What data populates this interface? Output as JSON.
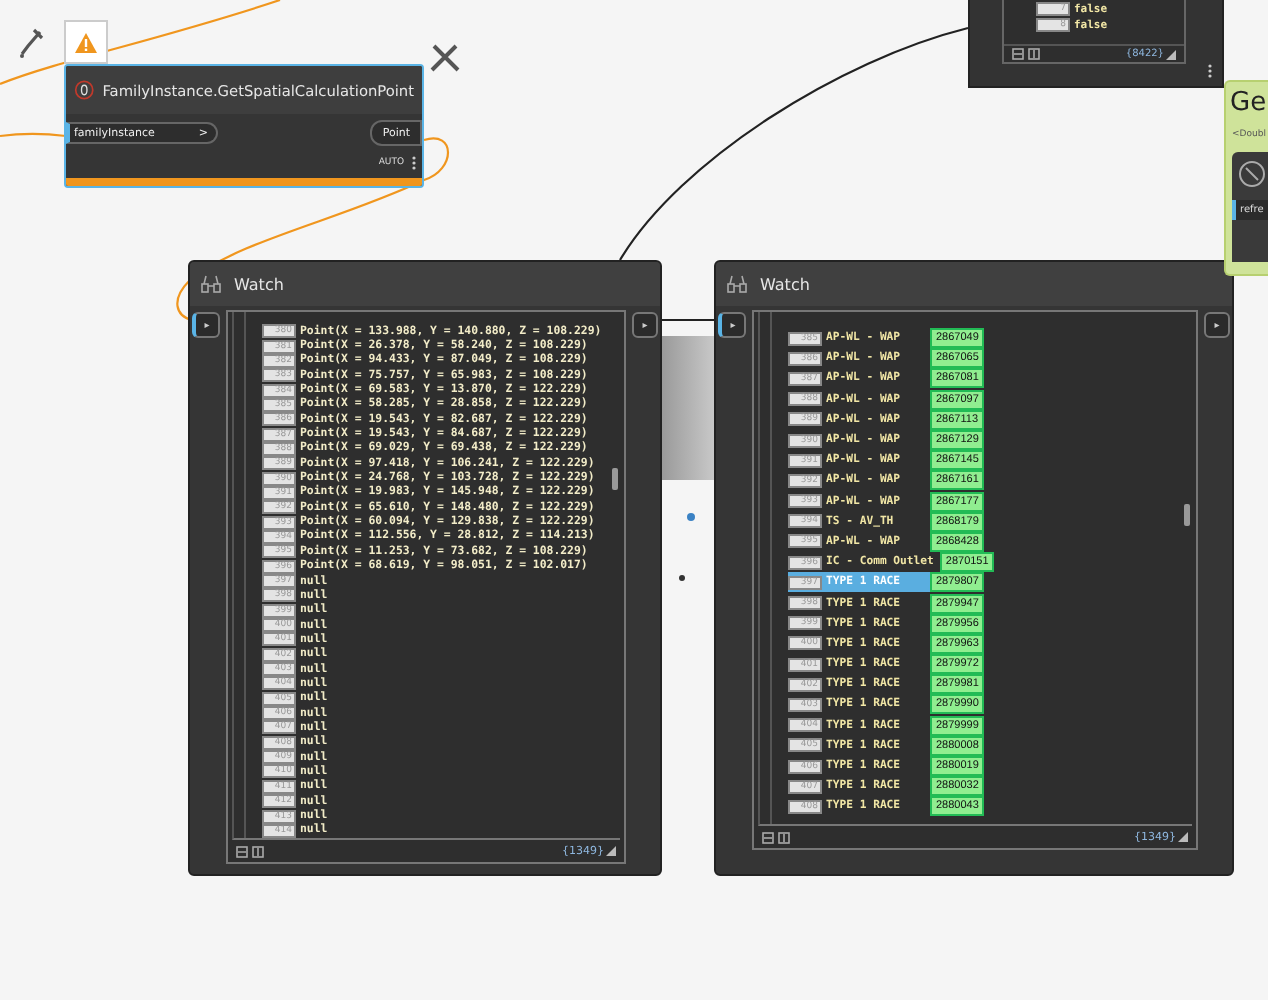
{
  "function_node": {
    "title": "FamilyInstance.GetSpatialCalculationPoint",
    "warning": true,
    "inputs": [
      {
        "label": "familyInstance",
        "arrow": ">"
      }
    ],
    "outputs": [
      "Point"
    ],
    "lacing": "AUTO"
  },
  "top_watch": {
    "rows": [
      {
        "index": "7",
        "value": "false"
      },
      {
        "index": "8",
        "value": "false"
      }
    ],
    "count": "{8422}"
  },
  "watch_nodes": [
    {
      "title": "Watch",
      "kind": "values",
      "input_arrow": "▸",
      "output_arrow": "▸",
      "count": "{1349}",
      "rows": [
        {
          "index": "380",
          "value": "Point(X = 133.988, Y = 140.880, Z = 108.229)"
        },
        {
          "index": "381",
          "value": "Point(X = 26.378, Y = 58.240, Z = 108.229)"
        },
        {
          "index": "382",
          "value": "Point(X = 94.433, Y = 87.049, Z = 108.229)"
        },
        {
          "index": "383",
          "value": "Point(X = 75.757, Y = 65.983, Z = 108.229)"
        },
        {
          "index": "384",
          "value": "Point(X = 69.583, Y = 13.870, Z = 122.229)"
        },
        {
          "index": "385",
          "value": "Point(X = 58.285, Y = 28.858, Z = 122.229)"
        },
        {
          "index": "386",
          "value": "Point(X = 19.543, Y = 82.687, Z = 122.229)"
        },
        {
          "index": "387",
          "value": "Point(X = 19.543, Y = 84.687, Z = 122.229)"
        },
        {
          "index": "388",
          "value": "Point(X = 69.029, Y = 69.438, Z = 122.229)"
        },
        {
          "index": "389",
          "value": "Point(X = 97.418, Y = 106.241, Z = 122.229)"
        },
        {
          "index": "390",
          "value": "Point(X = 24.768, Y = 103.728, Z = 122.229)"
        },
        {
          "index": "391",
          "value": "Point(X = 19.983, Y = 145.948, Z = 122.229)"
        },
        {
          "index": "392",
          "value": "Point(X = 65.610, Y = 148.480, Z = 122.229)"
        },
        {
          "index": "393",
          "value": "Point(X = 60.094, Y = 129.838, Z = 122.229)"
        },
        {
          "index": "394",
          "value": "Point(X = 112.556, Y = 28.812, Z = 114.213)"
        },
        {
          "index": "395",
          "value": "Point(X = 11.253, Y = 73.682, Z = 108.229)"
        },
        {
          "index": "396",
          "value": "Point(X = 68.619, Y = 98.051, Z = 102.017)"
        },
        {
          "index": "397",
          "value": "null"
        },
        {
          "index": "398",
          "value": "null"
        },
        {
          "index": "399",
          "value": "null"
        },
        {
          "index": "400",
          "value": "null"
        },
        {
          "index": "401",
          "value": "null"
        },
        {
          "index": "402",
          "value": "null"
        },
        {
          "index": "403",
          "value": "null"
        },
        {
          "index": "404",
          "value": "null"
        },
        {
          "index": "405",
          "value": "null"
        },
        {
          "index": "406",
          "value": "null"
        },
        {
          "index": "407",
          "value": "null"
        },
        {
          "index": "408",
          "value": "null"
        },
        {
          "index": "409",
          "value": "null"
        },
        {
          "index": "410",
          "value": "null"
        },
        {
          "index": "411",
          "value": "null"
        },
        {
          "index": "412",
          "value": "null"
        },
        {
          "index": "413",
          "value": "null"
        },
        {
          "index": "414",
          "value": "null"
        }
      ]
    },
    {
      "title": "Watch",
      "kind": "elements",
      "input_arrow": "▸",
      "output_arrow": "▸",
      "count": "{1349}",
      "rows": [
        {
          "index": "385",
          "name": "AP-WL - WAP",
          "id": "2867049",
          "selected": false
        },
        {
          "index": "386",
          "name": "AP-WL - WAP",
          "id": "2867065",
          "selected": false
        },
        {
          "index": "387",
          "name": "AP-WL - WAP",
          "id": "2867081",
          "selected": false
        },
        {
          "index": "388",
          "name": "AP-WL - WAP",
          "id": "2867097",
          "selected": false
        },
        {
          "index": "389",
          "name": "AP-WL - WAP",
          "id": "2867113",
          "selected": false
        },
        {
          "index": "390",
          "name": "AP-WL - WAP",
          "id": "2867129",
          "selected": false
        },
        {
          "index": "391",
          "name": "AP-WL - WAP",
          "id": "2867145",
          "selected": false
        },
        {
          "index": "392",
          "name": "AP-WL - WAP",
          "id": "2867161",
          "selected": false
        },
        {
          "index": "393",
          "name": "AP-WL - WAP",
          "id": "2867177",
          "selected": false
        },
        {
          "index": "394",
          "name": "TS - AV_TH",
          "id": "2868179",
          "selected": false
        },
        {
          "index": "395",
          "name": "AP-WL - WAP",
          "id": "2868428",
          "selected": false
        },
        {
          "index": "396",
          "name": "IC - Comm Outlet",
          "id": "2870151",
          "selected": false
        },
        {
          "index": "397",
          "name": "TYPE 1 RACE",
          "id": "2879807",
          "selected": true
        },
        {
          "index": "398",
          "name": "TYPE 1 RACE",
          "id": "2879947",
          "selected": false
        },
        {
          "index": "399",
          "name": "TYPE 1 RACE",
          "id": "2879956",
          "selected": false
        },
        {
          "index": "400",
          "name": "TYPE 1 RACE",
          "id": "2879963",
          "selected": false
        },
        {
          "index": "401",
          "name": "TYPE 1 RACE",
          "id": "2879972",
          "selected": false
        },
        {
          "index": "402",
          "name": "TYPE 1 RACE",
          "id": "2879981",
          "selected": false
        },
        {
          "index": "403",
          "name": "TYPE 1 RACE",
          "id": "2879990",
          "selected": false
        },
        {
          "index": "404",
          "name": "TYPE 1 RACE",
          "id": "2879999",
          "selected": false
        },
        {
          "index": "405",
          "name": "TYPE 1 RACE",
          "id": "2880008",
          "selected": false
        },
        {
          "index": "406",
          "name": "TYPE 1 RACE",
          "id": "2880019",
          "selected": false
        },
        {
          "index": "407",
          "name": "TYPE 1 RACE",
          "id": "2880032",
          "selected": false
        },
        {
          "index": "408",
          "name": "TYPE 1 RACE",
          "id": "2880043",
          "selected": false
        }
      ]
    }
  ],
  "partial_node": {
    "title": "Ge",
    "subtitle": "<Doubl",
    "input": "refre"
  }
}
